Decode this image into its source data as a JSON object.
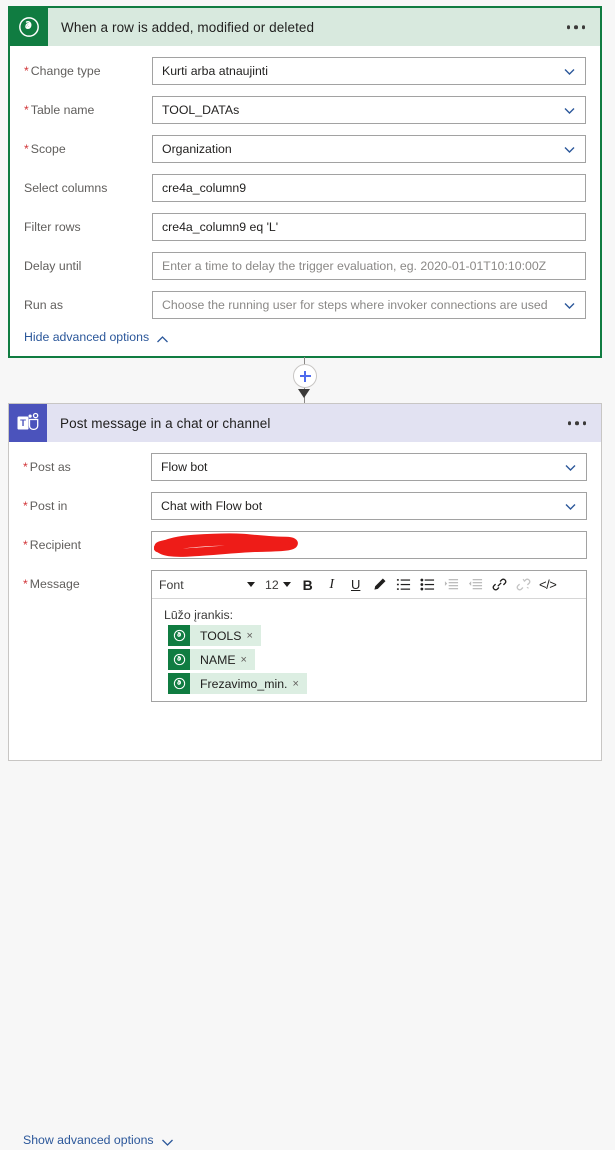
{
  "trigger": {
    "title": "When a row is added, modified or deleted",
    "icon": "dataverse-icon",
    "menu": "more-options",
    "fields": [
      {
        "label": "Change type",
        "required": true,
        "value": "Kurti arba atnaujinti",
        "placeholder": "",
        "dropdown": true
      },
      {
        "label": "Table name",
        "required": true,
        "value": "TOOL_DATAs",
        "placeholder": "",
        "dropdown": true
      },
      {
        "label": "Scope",
        "required": true,
        "value": "Organization",
        "placeholder": "",
        "dropdown": true
      },
      {
        "label": "Select columns",
        "required": false,
        "value": "cre4a_column9",
        "placeholder": "",
        "dropdown": false
      },
      {
        "label": "Filter rows",
        "required": false,
        "value": "cre4a_column9 eq 'L'",
        "placeholder": "",
        "dropdown": false
      },
      {
        "label": "Delay until",
        "required": false,
        "value": "",
        "placeholder": "Enter a time to delay the trigger evaluation, eg. 2020-01-01T10:10:00Z",
        "dropdown": false
      },
      {
        "label": "Run as",
        "required": false,
        "value": "",
        "placeholder": "Choose the running user for steps where invoker connections are used",
        "dropdown": true
      }
    ],
    "advanced_toggle": "Hide advanced options",
    "accent_color": "#107c41",
    "header_color": "#d8e9de"
  },
  "connector": {
    "add_button": "insert-new-step"
  },
  "action": {
    "title": "Post message in a chat or channel",
    "icon": "teams-icon",
    "menu": "more-options",
    "fields": [
      {
        "label": "Post as",
        "required": true,
        "value": "Flow bot",
        "placeholder": "",
        "dropdown": true
      },
      {
        "label": "Post in",
        "required": true,
        "value": "Chat with Flow bot",
        "placeholder": "",
        "dropdown": true
      },
      {
        "label": "Recipient",
        "required": true,
        "value": "",
        "placeholder": "",
        "dropdown": false,
        "redacted": true
      }
    ],
    "message": {
      "label": "Message",
      "required": true,
      "toolbar": {
        "font_label": "Font",
        "size_label": "12",
        "buttons": [
          {
            "name": "bold-button",
            "glyph": "B",
            "disabled": false
          },
          {
            "name": "italic-button",
            "glyph": "I",
            "disabled": false
          },
          {
            "name": "underline-button",
            "glyph": "U",
            "disabled": false
          },
          {
            "name": "font-color-button",
            "glyph": "pen",
            "disabled": false
          },
          {
            "name": "numbered-list-button",
            "glyph": "ol",
            "disabled": false
          },
          {
            "name": "bulleted-list-button",
            "glyph": "ul",
            "disabled": false
          },
          {
            "name": "indent-increase-button",
            "glyph": "in",
            "disabled": true
          },
          {
            "name": "indent-decrease-button",
            "glyph": "out",
            "disabled": true
          },
          {
            "name": "link-button",
            "glyph": "link",
            "disabled": false
          },
          {
            "name": "unlink-button",
            "glyph": "unlink",
            "disabled": true
          },
          {
            "name": "code-view-button",
            "glyph": "</>",
            "disabled": false
          }
        ]
      },
      "body_text": "Lūžo įrankis:",
      "tokens": [
        {
          "label": "TOOLS",
          "remove": "×"
        },
        {
          "label": "NAME",
          "remove": "×"
        },
        {
          "label": "Frezavimo_min.",
          "remove": "×"
        }
      ]
    },
    "advanced_toggle": "Show advanced options",
    "accent_color": "#4b53bc",
    "header_color": "#e2e2f2"
  }
}
